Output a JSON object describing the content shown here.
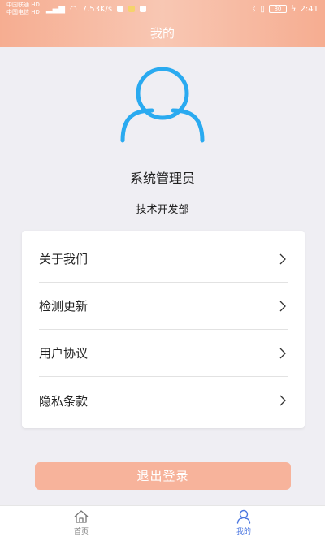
{
  "status_bar": {
    "carrier1": "中国联通 HD",
    "carrier2": "中国电信 HD",
    "speed": "7.53K/s",
    "battery": "80",
    "time": "2:41"
  },
  "header": {
    "title": "我的"
  },
  "profile": {
    "name": "系统管理员",
    "department": "技术开发部"
  },
  "menu": {
    "items": [
      {
        "label": "关于我们"
      },
      {
        "label": "检测更新"
      },
      {
        "label": "用户协议"
      },
      {
        "label": "隐私条款"
      }
    ]
  },
  "logout": {
    "label": "退出登录"
  },
  "tabbar": {
    "home_label": "首页",
    "mine_label": "我的"
  },
  "colors": {
    "header_gradient": "#f6ad91",
    "avatar_blue": "#2aaaf0",
    "logout_bg": "#f7b39b",
    "active_tab": "#4a76e0"
  }
}
